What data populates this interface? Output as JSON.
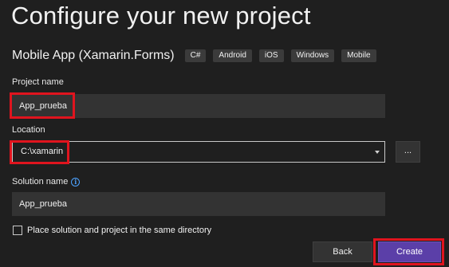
{
  "header": {
    "title": "Configure your new project",
    "template_name": "Mobile App (Xamarin.Forms)",
    "tags": [
      "C#",
      "Android",
      "iOS",
      "Windows",
      "Mobile"
    ]
  },
  "form": {
    "project_name": {
      "label": "Project name",
      "value": "App_prueba"
    },
    "location": {
      "label": "Location",
      "value": "C:\\xamarin",
      "browse_label": "..."
    },
    "solution_name": {
      "label": "Solution name",
      "value": "App_prueba",
      "info_icon": "info-icon"
    },
    "same_directory": {
      "label": "Place solution and project in the same directory",
      "checked": false
    }
  },
  "footer": {
    "back_label": "Back",
    "create_label": "Create"
  },
  "colors": {
    "background": "#1f1f1f",
    "input": "#333333",
    "accent": "#5b3fa8",
    "highlight": "#e0141e",
    "info": "#4da3ff"
  }
}
